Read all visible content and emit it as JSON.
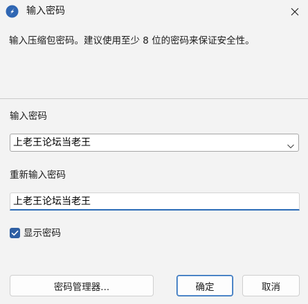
{
  "window": {
    "title": "输入密码"
  },
  "description": "输入压缩包密码。建议使用至少 8 位的密码来保证安全性。",
  "password": {
    "label": "输入密码",
    "value": "上老王论坛当老王"
  },
  "reenter": {
    "label": "重新输入密码",
    "value": "上老王论坛当老王"
  },
  "show_password": {
    "label": "显示密码",
    "checked": true
  },
  "buttons": {
    "manager": "密码管理器...",
    "ok": "确定",
    "cancel": "取消"
  },
  "colors": {
    "accent": "#2b6cb7",
    "checkbox": "#2e5fa3",
    "background": "#f3f3f3"
  }
}
